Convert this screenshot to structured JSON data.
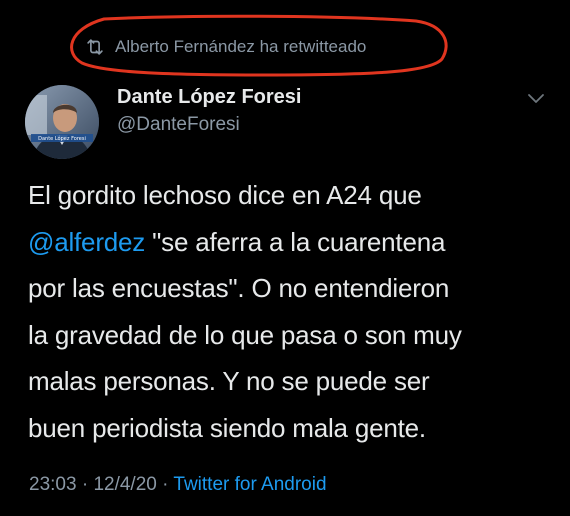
{
  "retweet": {
    "icon": "retweet-icon",
    "text": "Alberto Fernández ha retwitteado"
  },
  "author": {
    "name": "Dante López Foresi",
    "handle": "@DanteForesi",
    "avatar_caption": "Dante López Foresi"
  },
  "tweet": {
    "line1": "El gordito lechoso dice en A24 que",
    "mention": "@alferdez",
    "line2_rest": " \"se aferra a la cuarentena",
    "line3": "por las encuestas\". O no entendieron",
    "line4": "la gravedad de lo que pasa o son muy",
    "line5": "malas personas. Y no se puede ser",
    "line6": "buen periodista siendo mala gente."
  },
  "meta": {
    "time": "23:03",
    "sep1": " · ",
    "date": "12/4/20",
    "sep2": " · ",
    "source": "Twitter for Android"
  },
  "colors": {
    "background": "#000000",
    "text": "#e7e9ea",
    "muted": "#8b98a5",
    "link": "#1d9bf0",
    "annotation": "#e0351f"
  }
}
